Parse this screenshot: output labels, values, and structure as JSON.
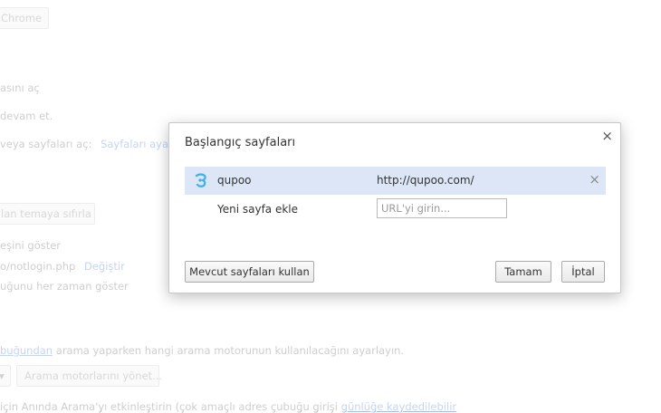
{
  "background": {
    "chrome_button": "Chrome",
    "line1": "asını aç",
    "line2": "devam et.",
    "line3": "veya sayfaları aç:",
    "line3_link": "Sayfaları ayarla",
    "reset_theme_button": "lan temaya sıfırla",
    "line4": "eşini göster",
    "line5": "o/notlogin.php",
    "line5_link": "Değiştir",
    "line6": "uğunu her zaman göster",
    "line7_link": "buğundan",
    "line7": "arama yaparken hangi arama motorunun kullanılacağını ayarlayın.",
    "manage_engines_button": "Arama motorlarını yönet...",
    "line8": "için Anında Arama'yı etkinleştirin (çok amaçlı adres çubuğu girişi",
    "line8_link": "günlüğe kaydedilebilir"
  },
  "dialog": {
    "title": "Başlangıç sayfaları",
    "close_glyph": "×",
    "pages": [
      {
        "name": "qupoo",
        "url": "http://qupoo.com/",
        "icon": "qupoo-favicon",
        "delete_glyph": "×"
      }
    ],
    "add_page_label": "Yeni sayfa ekle",
    "url_placeholder": "URL'yi girin...",
    "use_current_button": "Mevcut sayfaları kullan",
    "ok_button": "Tamam",
    "cancel_button": "İptal"
  },
  "colors": {
    "selected_row": "#dce6f6",
    "favicon": "#3bb2e6"
  }
}
